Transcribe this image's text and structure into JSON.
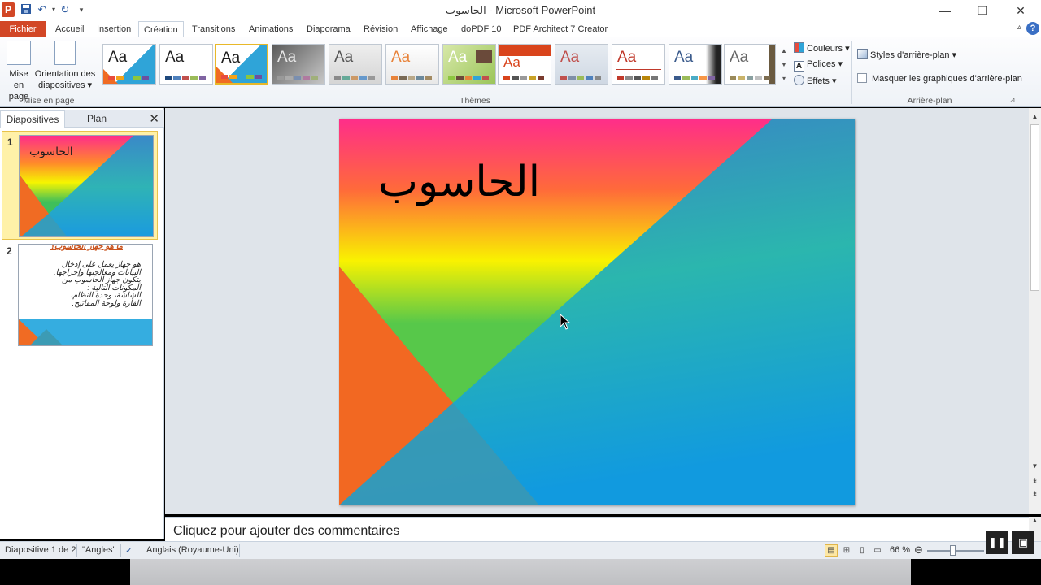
{
  "titlebar": {
    "title": "الحاسوب - Microsoft PowerPoint",
    "app_icon": "P",
    "quick_access": [
      "save-icon",
      "undo-icon",
      "redo-icon",
      "customize-icon"
    ]
  },
  "tabs": {
    "file": "Fichier",
    "items": [
      "Accueil",
      "Insertion",
      "Création",
      "Transitions",
      "Animations",
      "Diaporama",
      "Révision",
      "Affichage",
      "doPDF 10",
      "PDF Architect 7 Creator"
    ],
    "active": "Création"
  },
  "ribbon": {
    "page_setup": {
      "btn1_line1": "Mise en",
      "btn1_line2": "page",
      "btn2_line1": "Orientation des",
      "btn2_line2": "diapositives ▾",
      "group": "Mise en page"
    },
    "themes": {
      "group": "Thèmes",
      "sample": "Aa"
    },
    "theme_options": {
      "colors": "Couleurs ▾",
      "fonts": "Polices ▾",
      "effects": "Effets ▾"
    },
    "background": {
      "styles": "Styles d'arrière-plan ▾",
      "hide_graphics": "Masquer les graphiques d'arrière-plan",
      "group": "Arrière-plan"
    }
  },
  "left_pane": {
    "tab_slides": "Diapositives",
    "tab_outline": "Plan",
    "slide1_num": "1",
    "slide1_title": "الحاسوب",
    "slide2_num": "2",
    "slide2_title": "ما هو جهاز الحاسوب؟",
    "slide2_l1": "هو جهاز يعمل على إدخال",
    "slide2_l2": "البيانات ومعالجتها وإخراجها.",
    "slide2_l3": "يتكون جهاز الحاسوب من",
    "slide2_l4": "المكونات التالية :",
    "slide2_l5": "الشاشة، وحدة النظام،",
    "slide2_l6": "الفأرة ولوحة المفاتيح."
  },
  "slide": {
    "title": "الحاسوب"
  },
  "notes": {
    "placeholder": "Cliquez pour ajouter des commentaires"
  },
  "statusbar": {
    "slide_info": "Diapositive 1 de 2",
    "theme": "\"Angles\"",
    "language": "Anglais (Royaume-Uni)",
    "zoom": "66 %"
  },
  "colors": {
    "file_tab": "#d24726",
    "selection": "#e8b829"
  }
}
